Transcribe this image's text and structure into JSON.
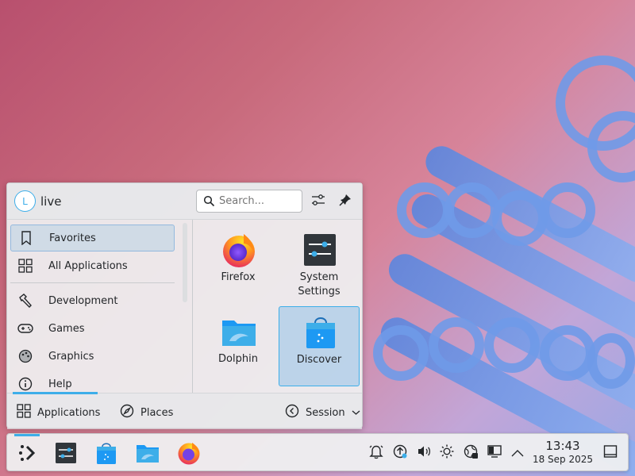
{
  "menu": {
    "user": {
      "avatar_letter": "L",
      "name": "live"
    },
    "search": {
      "placeholder": "Search...",
      "value": ""
    },
    "icons": {
      "configure": "sliders-icon",
      "pin": "pin-icon"
    },
    "categories": [
      {
        "label": "Favorites",
        "icon": "bookmark-icon",
        "active": true
      },
      {
        "label": "All Applications",
        "icon": "grid-icon"
      },
      {
        "label": "Development",
        "icon": "hammer-icon"
      },
      {
        "label": "Games",
        "icon": "gamepad-icon"
      },
      {
        "label": "Graphics",
        "icon": "palette-icon"
      },
      {
        "label": "Help",
        "icon": "info-icon"
      }
    ],
    "favorites": [
      {
        "label": "Firefox",
        "icon": "firefox-icon"
      },
      {
        "label": "System Settings",
        "icon": "system-settings-icon"
      },
      {
        "label": "Dolphin",
        "icon": "dolphin-folder-icon"
      },
      {
        "label": "Discover",
        "icon": "discover-bag-icon",
        "selected": true
      }
    ],
    "footer": {
      "applications": "Applications",
      "places": "Places",
      "session": "Session"
    }
  },
  "panel": {
    "tasks": [
      "system-settings-icon",
      "discover-bag-icon",
      "dolphin-folder-icon",
      "firefox-icon"
    ],
    "tray": [
      "notifications-icon",
      "updates-icon",
      "volume-icon",
      "brightness-icon",
      "network-icon",
      "display-icon",
      "chevron-up-icon"
    ],
    "clock": {
      "time": "13:43",
      "date": "18 Sep 2025"
    }
  },
  "colors": {
    "accent": "#3daee9",
    "panel": "#eff0f1"
  }
}
